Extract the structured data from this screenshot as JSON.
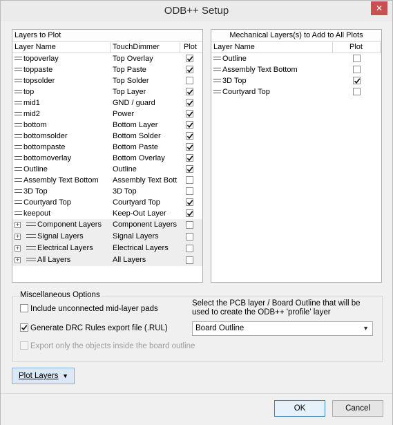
{
  "window": {
    "title": "ODB++ Setup",
    "close_glyph": "✕"
  },
  "layers_panel": {
    "title": "Layers to Plot",
    "columns": {
      "name": "Layer Name",
      "touch": "TouchDimmer",
      "plot": "Plot"
    },
    "rows": [
      {
        "name": "topoverlay",
        "touch": "Top Overlay",
        "plot": true
      },
      {
        "name": "toppaste",
        "touch": "Top Paste",
        "plot": true
      },
      {
        "name": "topsolder",
        "touch": "Top Solder",
        "plot": false
      },
      {
        "name": "top",
        "touch": "Top Layer",
        "plot": true
      },
      {
        "name": "mid1",
        "touch": "GND / guard",
        "plot": true
      },
      {
        "name": "mid2",
        "touch": "Power",
        "plot": true
      },
      {
        "name": "bottom",
        "touch": "Bottom Layer",
        "plot": true
      },
      {
        "name": "bottomsolder",
        "touch": "Bottom Solder",
        "plot": true
      },
      {
        "name": "bottompaste",
        "touch": "Bottom Paste",
        "plot": true
      },
      {
        "name": "bottomoverlay",
        "touch": "Bottom Overlay",
        "plot": true
      },
      {
        "name": "Outline",
        "touch": "Outline",
        "plot": true
      },
      {
        "name": "Assembly Text Bottom",
        "touch": "Assembly Text Bott",
        "plot": false
      },
      {
        "name": "3D Top",
        "touch": "3D Top",
        "plot": false
      },
      {
        "name": "Courtyard Top",
        "touch": "Courtyard Top",
        "plot": true
      },
      {
        "name": "keepout",
        "touch": "Keep-Out Layer",
        "plot": true
      }
    ],
    "groups": [
      {
        "name": "Component Layers",
        "touch": "Component Layers",
        "plot": false
      },
      {
        "name": "Signal Layers",
        "touch": "Signal Layers",
        "plot": false
      },
      {
        "name": "Electrical Layers",
        "touch": "Electrical Layers",
        "plot": false
      },
      {
        "name": "All Layers",
        "touch": "All Layers",
        "plot": false
      }
    ]
  },
  "mech_panel": {
    "title": "Mechanical Layers(s) to Add to All Plots",
    "columns": {
      "name": "Layer Name",
      "plot": "Plot"
    },
    "rows": [
      {
        "name": "Outline",
        "plot": false
      },
      {
        "name": "Assembly Text Bottom",
        "plot": false
      },
      {
        "name": "3D Top",
        "plot": true
      },
      {
        "name": "Courtyard Top",
        "plot": false
      }
    ]
  },
  "misc": {
    "legend": "Miscellaneous Options",
    "include_unconnected": {
      "label": "Include unconnected mid-layer pads",
      "checked": false
    },
    "generate_drc": {
      "label": "Generate DRC Rules export file (.RUL)",
      "checked": true
    },
    "export_only": {
      "label": "Export only the objects inside the board outline",
      "checked": false,
      "disabled": true
    },
    "profile_hint": "Select the PCB layer / Board Outline that will be used to create the ODB++ 'profile' layer",
    "profile_select": {
      "value": "Board Outline"
    }
  },
  "buttons": {
    "plot_layers": "Plot Layers",
    "ok": "OK",
    "cancel": "Cancel"
  }
}
